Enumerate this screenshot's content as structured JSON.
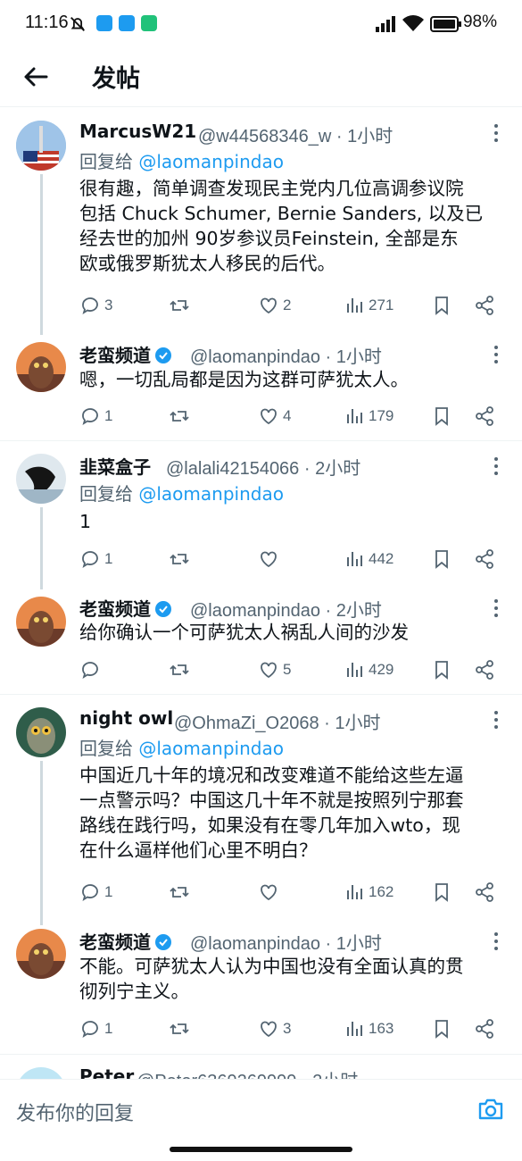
{
  "status_bar": {
    "time": "11:16",
    "battery": "98%"
  },
  "header": {
    "title": "发帖"
  },
  "posts": [
    {
      "name": "MarcusW21",
      "handle": "@w44568346_w · 1小时",
      "reply_to_label": "回复给",
      "reply_to_handle": "@laomanpindao",
      "lines": [
        "很有趣，简单调查发现民主党内几位高调参议院",
        "包括 Chuck Schumer, Bernie Sanders, 以及已",
        "经去世的加州 90岁参议员Feinstein, 全部是东",
        "欧或俄罗斯犹太人移民的后代。"
      ],
      "replies": "3",
      "likes": "2",
      "views": "271"
    },
    {
      "name": "老蛮频道",
      "handle": "@laomanpindao · 1小时",
      "lines": [
        "嗯，一切乱局都是因为这群可萨犹太人。"
      ],
      "replies": "1",
      "likes": "4",
      "views": "179"
    },
    {
      "name": "韭菜盒子",
      "handle": "@lalali42154066 · 2小时",
      "reply_to_label": "回复给",
      "reply_to_handle": "@laomanpindao",
      "lines": [
        "1"
      ],
      "replies": "1",
      "likes": "",
      "views": "442"
    },
    {
      "name": "老蛮频道",
      "handle": "@laomanpindao · 2小时",
      "lines": [
        "给你确认一个可萨犹太人祸乱人间的沙发"
      ],
      "replies": "",
      "likes": "5",
      "views": "429"
    },
    {
      "name": "night owl",
      "handle": "@OhmaZi_O2068 · 1小时",
      "reply_to_label": "回复给",
      "reply_to_handle": "@laomanpindao",
      "lines": [
        "中国近几十年的境况和改变难道不能给这些左逼",
        "一点警示吗？中国这几十年不就是按照列宁那套",
        "路线在践行吗，如果没有在零几年加入wto，现",
        "在什么逼样他们心里不明白？"
      ],
      "replies": "1",
      "likes": "",
      "views": "162"
    },
    {
      "name": "老蛮频道",
      "handle": "@laomanpindao · 1小时",
      "lines": [
        "不能。可萨犹太人认为中国也没有全面认真的贯",
        "彻列宁主义。"
      ],
      "replies": "1",
      "likes": "3",
      "views": "163"
    }
  ],
  "partial_post": {
    "name": "Peter",
    "handle": "@Peter6369269999 · 2小时"
  },
  "reply_bar": {
    "placeholder": "发布你的回复"
  },
  "colors": {
    "accent": "#1d9bf0",
    "muted": "#536471",
    "verified": "#1d9bf0"
  }
}
